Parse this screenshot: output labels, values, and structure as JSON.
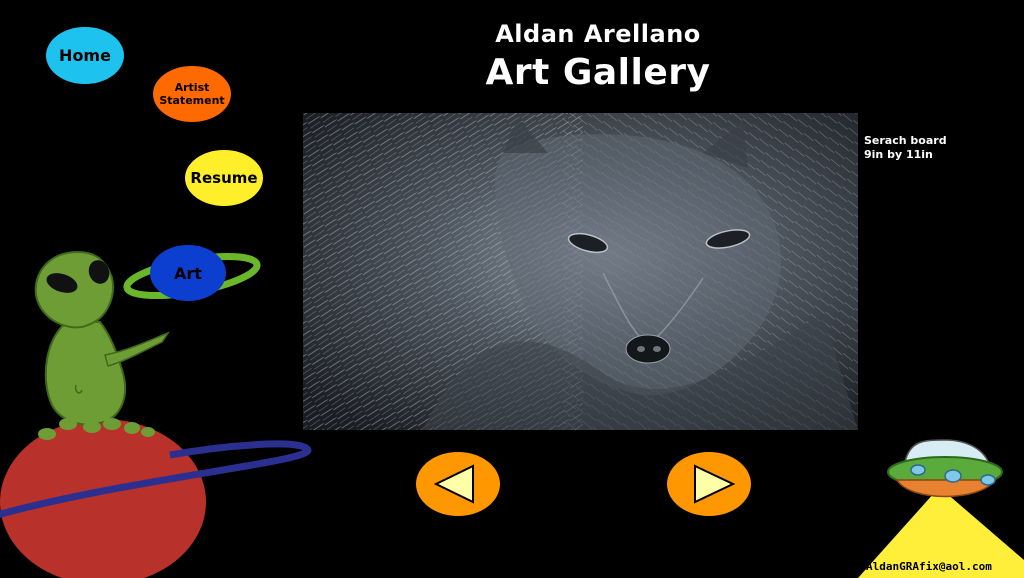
{
  "header": {
    "artist_name": "Aldan Arellano",
    "page_title": "Art Gallery"
  },
  "nav": {
    "home": "Home",
    "artist_statement_line1": "Artist",
    "artist_statement_line2": "Statement",
    "resume": "Resume",
    "art": "Art"
  },
  "artwork": {
    "caption_line1": "Serach board",
    "caption_line2": "9in by 11in",
    "subject": "wolf"
  },
  "controls": {
    "prev_icon": "left-triangle-icon",
    "next_icon": "right-triangle-icon"
  },
  "footer": {
    "email": "AldanGRAfix@aol.com"
  },
  "colors": {
    "background": "#000000",
    "home": "#1ec2ef",
    "artist_statement": "#ff6a00",
    "resume": "#ffef2a",
    "art": "#0c3fcf",
    "planet_ring": "#6ab82a",
    "arrow_button": "#ff9800",
    "arrow_triangle": "#ffffa8",
    "alien": "#6f9d35",
    "red_planet": "#b8312b",
    "ufo_beam": "#ffef3a"
  }
}
